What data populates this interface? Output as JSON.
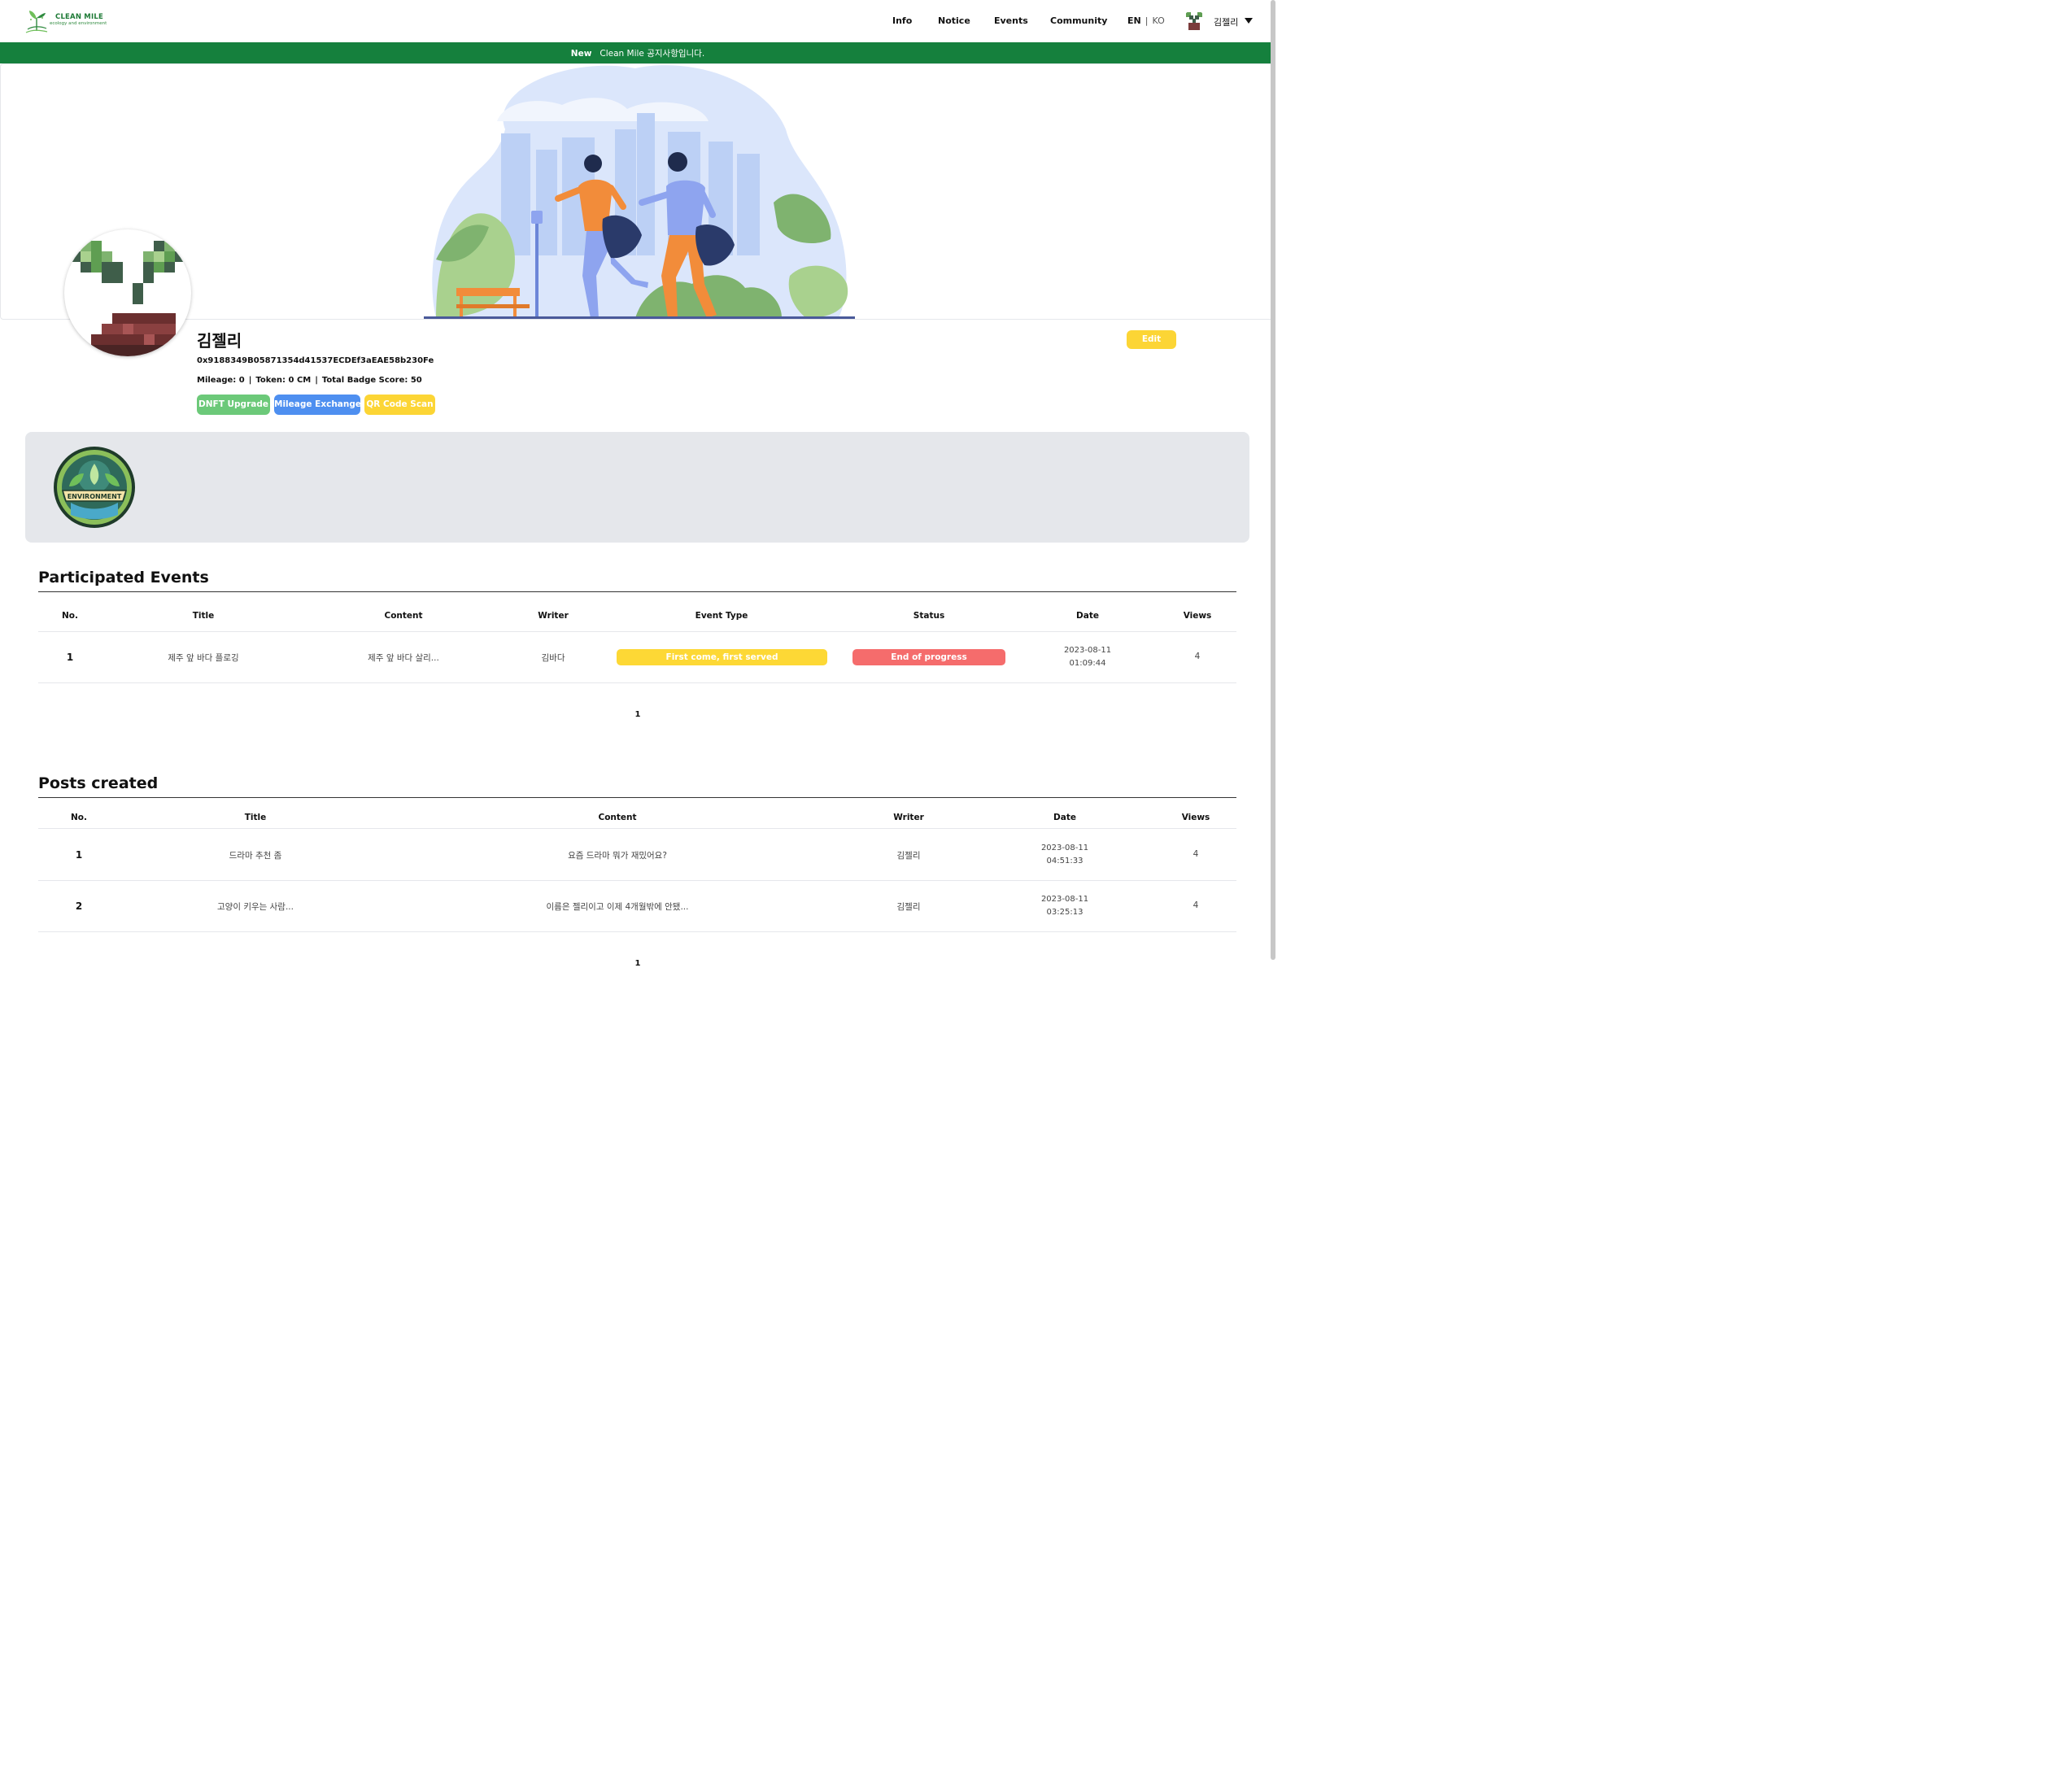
{
  "header": {
    "logo_title": "CLEAN MILE",
    "logo_subtitle": "ecology and environment",
    "nav": [
      "Info",
      "Notice",
      "Events",
      "Community"
    ],
    "lang_en": "EN",
    "lang_sep": "|",
    "lang_ko": "KO",
    "user_name": "김젤리"
  },
  "notice": {
    "tag": "New",
    "text": "Clean Mile 공지사항입니다."
  },
  "profile": {
    "name": "김젤리",
    "wallet": "0x9188349B05871354d41537ECDEf3aEAE58b230Fe",
    "mileage": "Mileage: 0",
    "token": "Token: 0 CM",
    "badge_score": "Total Badge Score: 50",
    "sep": "|",
    "edit_label": "Edit",
    "actions": [
      {
        "label": "DNFT Upgrade",
        "color": "#6cc979"
      },
      {
        "label": "Mileage Exchange",
        "color": "#4e8ff0"
      },
      {
        "label": "QR Code Scan",
        "color": "#fcd535"
      }
    ]
  },
  "badge": {
    "text": "ENVIRONMENT"
  },
  "events": {
    "title": "Participated Events",
    "columns": [
      "No.",
      "Title",
      "Content",
      "Writer",
      "Event Type",
      "Status",
      "Date",
      "Views"
    ],
    "rows": [
      {
        "no": "1",
        "title": "제주 앞 바다 플로깅",
        "content": "제주 앞 바다 살리...",
        "writer": "김바다",
        "event_type": "First come, first served",
        "status": "End of progress",
        "date": "2023-08-11",
        "time": "01:09:44",
        "views": "4"
      }
    ],
    "page": "1",
    "event_type_color": "#fdd835",
    "status_color": "#f56c6c"
  },
  "posts": {
    "title": "Posts created",
    "columns": [
      "No.",
      "Title",
      "Content",
      "Writer",
      "Date",
      "Views"
    ],
    "rows": [
      {
        "no": "1",
        "title": "드라마 추천 좀",
        "content": "요즘 드라마 뭐가 재밌어요?",
        "writer": "김젤리",
        "date": "2023-08-11",
        "time": "04:51:33",
        "views": "4"
      },
      {
        "no": "2",
        "title": "고양이 키우는 사람...",
        "content": "이름은 젤리이고 이제 4개월밖에 안됐...",
        "writer": "김젤리",
        "date": "2023-08-11",
        "time": "03:25:13",
        "views": "4"
      }
    ],
    "page": "1"
  },
  "colors": {
    "brand_green": "#15803d",
    "badge_panel": "#e5e7eb"
  },
  "icons": {
    "logo": "sprout-logo-icon",
    "caret": "caret-down-icon",
    "avatar": "pixel-sprout-avatar",
    "badge": "environment-badge-icon"
  }
}
